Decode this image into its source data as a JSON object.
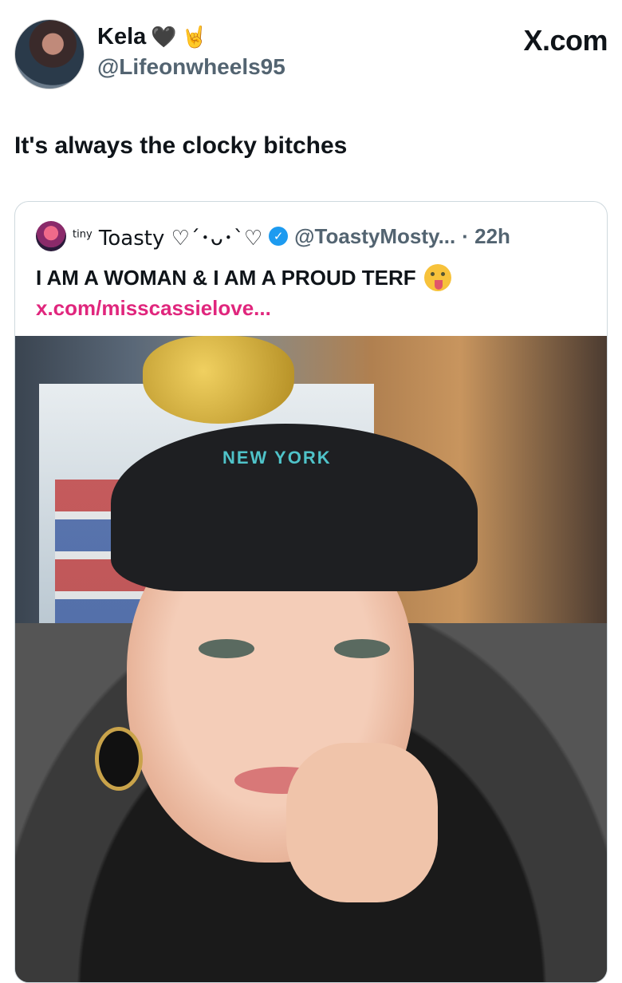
{
  "author": {
    "name": "Kela",
    "emoji": [
      "🖤",
      "🤘"
    ],
    "handle": "@Lifeonwheels95"
  },
  "site_label": "X.com",
  "tweet_text": "It's always the clocky bitches",
  "quoted_tweet": {
    "name_prefix": "tiny",
    "name": "Toasty ♡´･ᴗ･`♡",
    "handle": "@ToastyMosty...",
    "time": "· 22h",
    "text": "I AM A WOMAN & I AM A PROUD TERF",
    "link": "x.com/misscassielove...",
    "photo_cap_text": "NEW YORK"
  },
  "colors": {
    "link": "#e0267d",
    "verified": "#1d9bf0",
    "secondary_text": "#536471"
  }
}
